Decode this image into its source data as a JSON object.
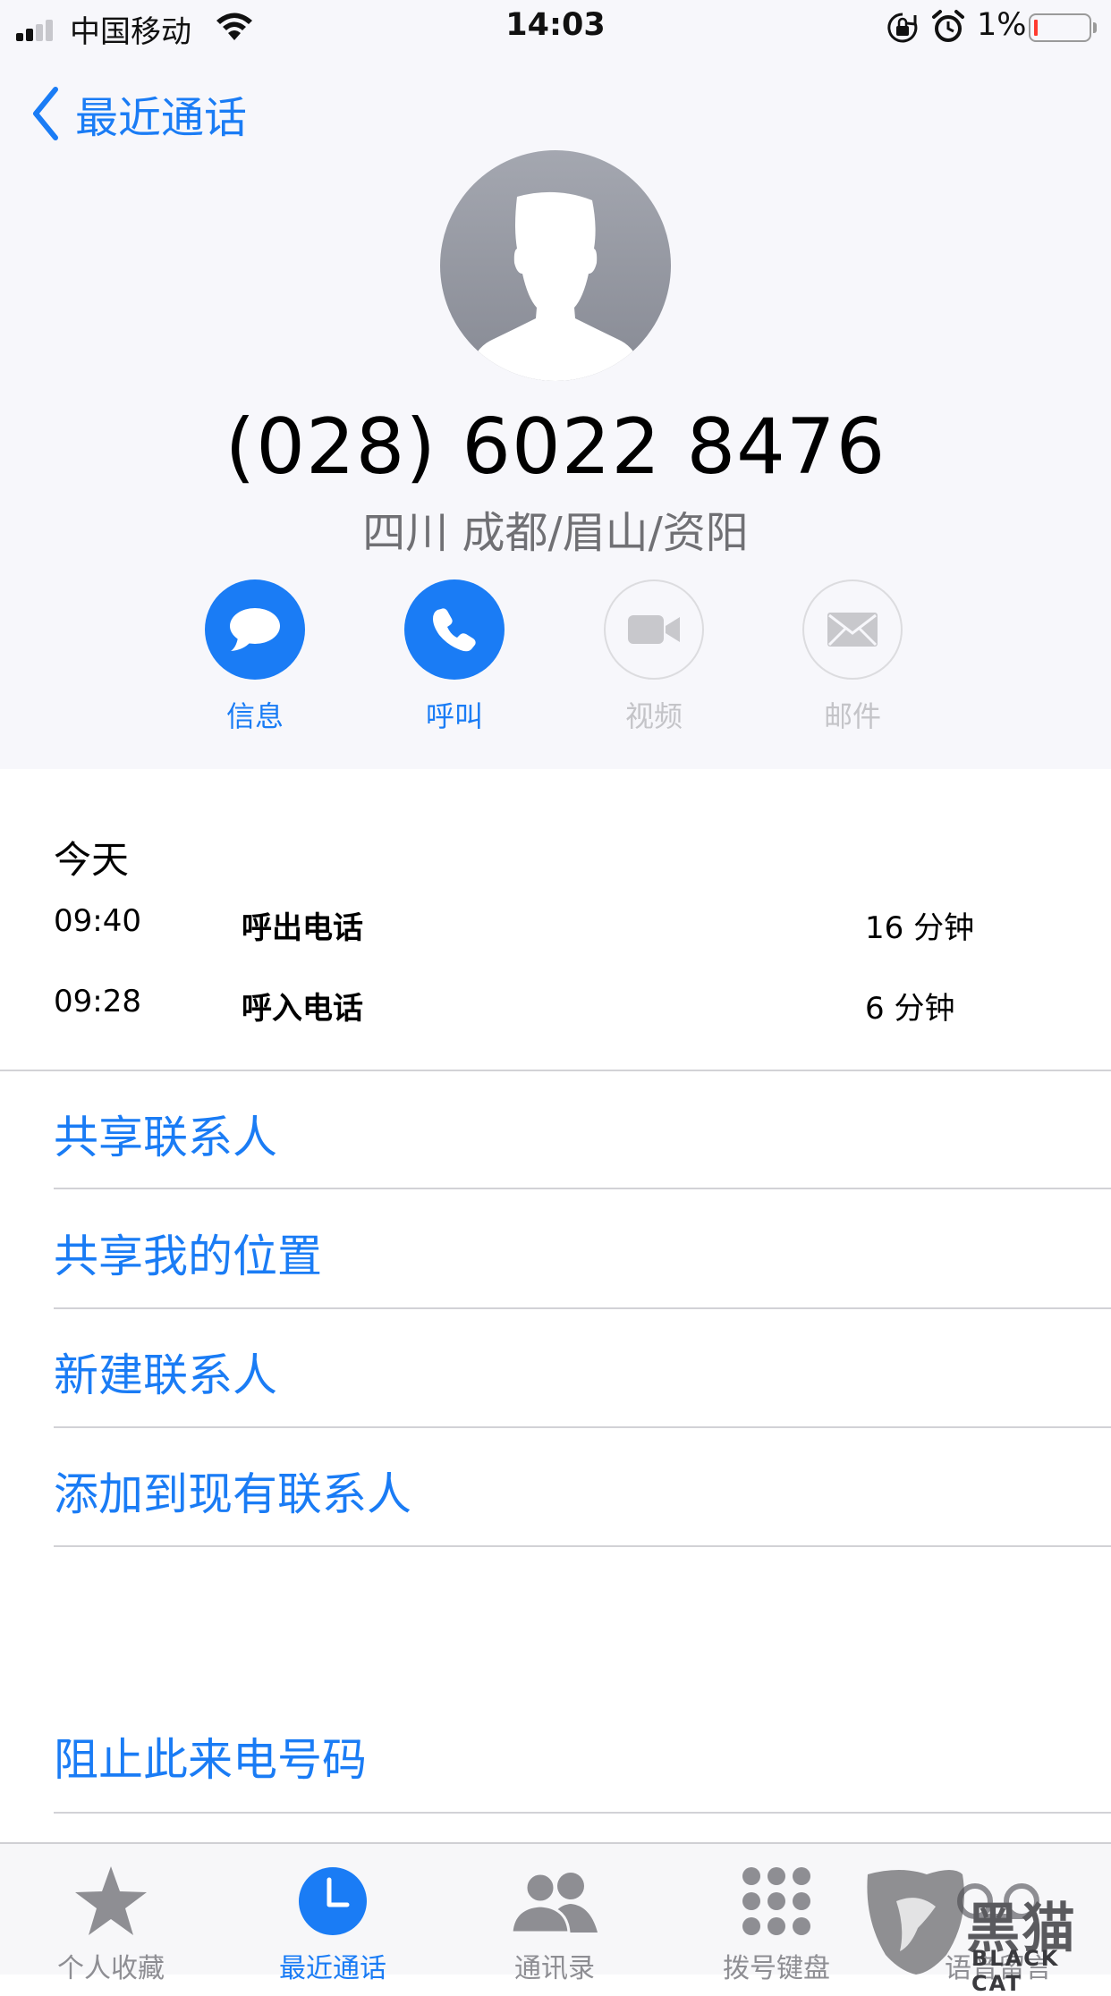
{
  "status_bar": {
    "carrier": "中国移动",
    "time": "14:03",
    "battery_percent": "1%",
    "battery_level": 0.01,
    "battery_color": "#ff3b30",
    "signal_bars": 2,
    "icons": [
      "signal-icon",
      "wifi-icon",
      "rotation-lock-icon",
      "alarm-icon",
      "battery-icon"
    ]
  },
  "nav": {
    "back_label": "最近通话",
    "accent": "#1a7cf5"
  },
  "contact": {
    "phone_number": "(028) 6022 8476",
    "location": "四川 成都/眉山/资阳"
  },
  "actions": [
    {
      "label": "信息",
      "icon": "message-bubble-icon",
      "enabled": true
    },
    {
      "label": "呼叫",
      "icon": "phone-icon",
      "enabled": true
    },
    {
      "label": "视频",
      "icon": "video-camera-icon",
      "enabled": false
    },
    {
      "label": "邮件",
      "icon": "mail-icon",
      "enabled": false
    }
  ],
  "history": {
    "date_header": "今天",
    "calls": [
      {
        "time": "09:40",
        "type": "呼出电话",
        "duration": "16 分钟"
      },
      {
        "time": "09:28",
        "type": "呼入电话",
        "duration": "6 分钟"
      }
    ]
  },
  "options": [
    "共享联系人",
    "共享我的位置",
    "新建联系人",
    "添加到现有联系人"
  ],
  "block_option": "阻止此来电号码",
  "tabs": [
    {
      "label": "个人收藏",
      "icon": "star-icon",
      "active": false
    },
    {
      "label": "最近通话",
      "icon": "clock-icon",
      "active": true
    },
    {
      "label": "通讯录",
      "icon": "contacts-icon",
      "active": false
    },
    {
      "label": "拨号键盘",
      "icon": "keypad-icon",
      "active": false
    },
    {
      "label": "语音留言",
      "icon": "voicemail-icon",
      "active": false
    }
  ],
  "watermark": {
    "text": "黑猫",
    "subtext": "BLACK CAT"
  }
}
